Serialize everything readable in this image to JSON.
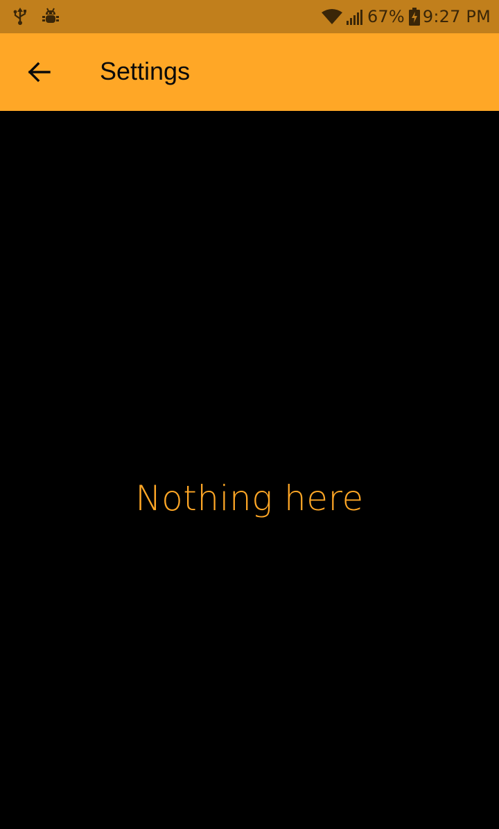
{
  "status_bar": {
    "battery_percent": "67%",
    "time": "9:27 PM",
    "left_icons": [
      "usb-icon",
      "android-debug-icon"
    ],
    "right_icons": [
      "wifi-icon",
      "signal-icon",
      "battery-charging-icon"
    ]
  },
  "app_bar": {
    "title": "Settings",
    "back_icon": "arrow-back-icon"
  },
  "content": {
    "empty_message": "Nothing here"
  },
  "colors": {
    "status_bar_bg": "#c17f1c",
    "app_bar_bg": "#ffa726",
    "accent": "#ffa726",
    "background": "#000000"
  }
}
